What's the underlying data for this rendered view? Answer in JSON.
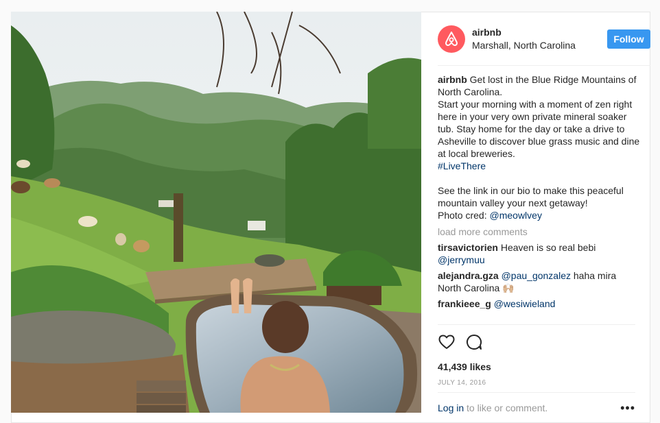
{
  "post": {
    "account": "airbnb",
    "location": "Marshall, North Carolina",
    "follow_label": "Follow",
    "caption_user": "airbnb",
    "caption_text_1": "Get lost in the Blue Ridge Mountains of North Carolina.",
    "caption_text_2": "Start your morning with a moment of zen right here in your very own private mineral soaker tub. Stay home for the day or take a drive to Asheville to discover blue grass music and dine at local breweries.",
    "hashtag": "#LiveThere",
    "caption_text_3": "See the link in our bio to make this peaceful mountain valley your next getaway!",
    "photo_cred_label": "Photo cred:",
    "photo_cred_user": "@meowlvey",
    "load_more": "load more comments",
    "comments": [
      {
        "user": "tirsavictorien",
        "text": "Heaven is so real bebi",
        "mention": "@jerrymuu",
        "after": ""
      },
      {
        "user": "alejandra.gza",
        "text": "",
        "mention": "@pau_gonzalez",
        "after": " haha mira North Carolina 🙌🏼"
      },
      {
        "user": "frankieee_g",
        "text": "",
        "mention": "@wesiwieland",
        "after": ""
      }
    ],
    "likes": "41,439 likes",
    "date": "JULY 14, 2016",
    "login_link": "Log in",
    "login_rest": " to like or comment.",
    "more_icon": "•••"
  },
  "icons": {
    "like": "heart-icon",
    "comment": "comment-bubble-icon",
    "logo": "airbnb-logo-icon"
  },
  "colors": {
    "follow": "#3897f0",
    "airbnb": "#ff5a5f",
    "link": "#003569",
    "muted": "#999999"
  }
}
